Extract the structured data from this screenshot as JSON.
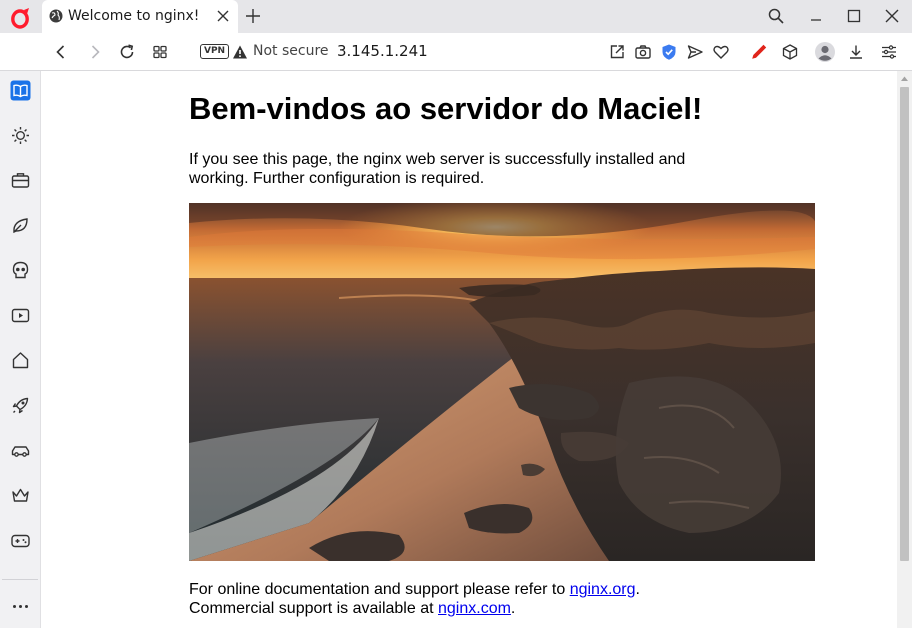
{
  "tab": {
    "title": "Welcome to nginx!"
  },
  "address_bar": {
    "vpn_label": "VPN",
    "security_text": "Not secure",
    "url": "3.145.1.241"
  },
  "page": {
    "heading": "Bem-vindos ao servidor do Maciel!",
    "intro": "If you see this page, the nginx web server is successfully installed and working. Further configuration is required.",
    "support_prefix": "For online documentation and support please refer to ",
    "docs_link": "nginx.org",
    "support_mid": ".",
    "commercial_prefix": "Commercial support is available at ",
    "commercial_link": "nginx.com",
    "commercial_suffix": "."
  },
  "sidebar": {
    "items": [
      "reader-icon",
      "weather-icon",
      "work-icon",
      "eco-icon",
      "skull-icon",
      "video-icon",
      "home-icon",
      "rocket-icon",
      "car-icon",
      "crown-icon",
      "gamepad-icon",
      "more-icon"
    ]
  },
  "colors": {
    "brand_red": "#ff1b2d",
    "sidebar_active": "#1a73e8",
    "link": "#0000ee",
    "shield_blue": "#3b7bf0",
    "pencil_red": "#e0241b"
  }
}
